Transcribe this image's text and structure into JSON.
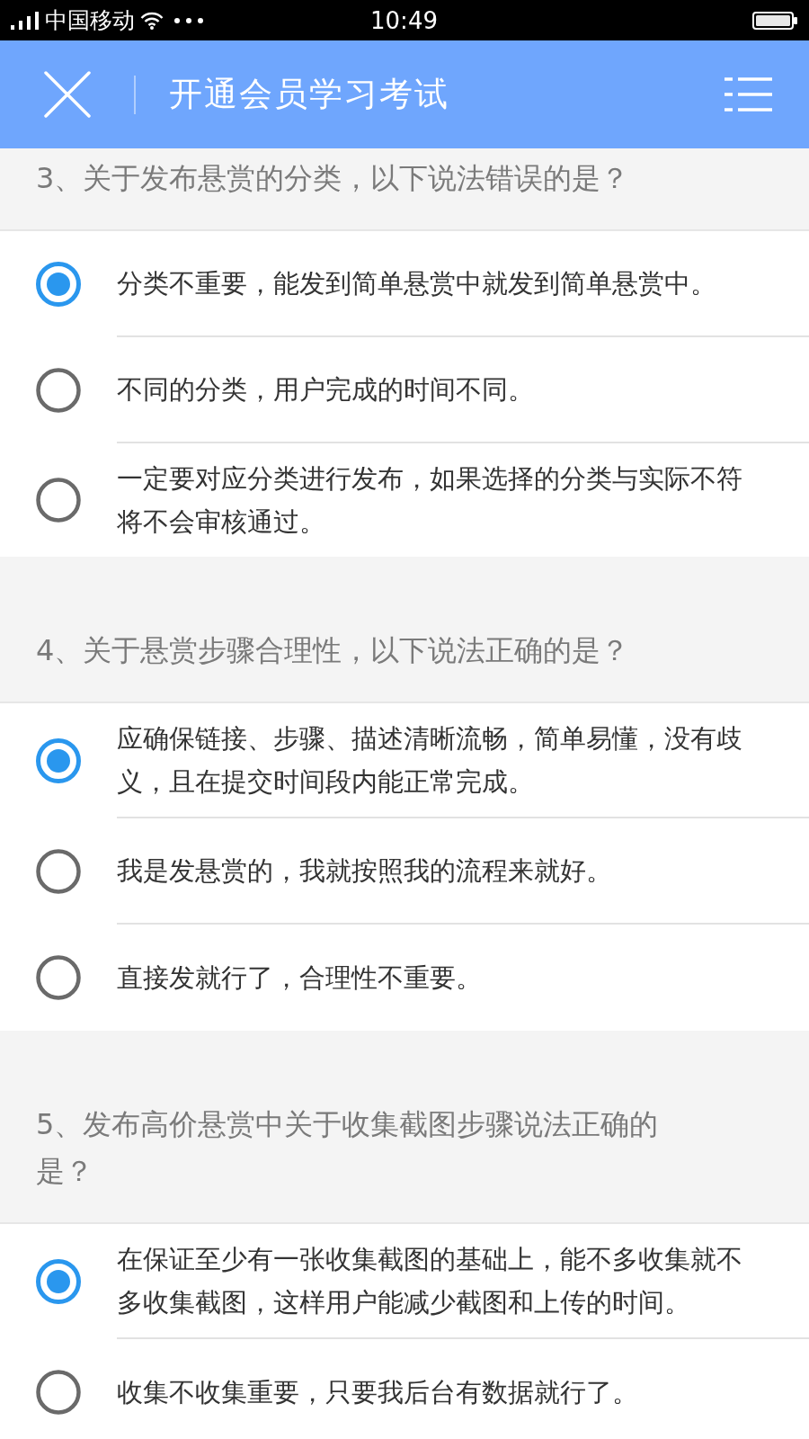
{
  "status_bar": {
    "carrier": "中国移动",
    "time": "10:49"
  },
  "header": {
    "title": "开通会员学习考试"
  },
  "questions": [
    {
      "text": "3、关于发布悬赏的分类，以下说法错误的是？",
      "options": [
        {
          "text": "分类不重要，能发到简单悬赏中就发到简单悬赏中。",
          "selected": true
        },
        {
          "text": "不同的分类，用户完成的时间不同。",
          "selected": false
        },
        {
          "text": "一定要对应分类进行发布，如果选择的分类与实际不符将不会审核通过。",
          "selected": false
        }
      ]
    },
    {
      "text": "4、关于悬赏步骤合理性，以下说法正确的是？",
      "options": [
        {
          "text": "应确保链接、步骤、描述清晰流畅，简单易懂，没有歧义，且在提交时间段内能正常完成。",
          "selected": true
        },
        {
          "text": "我是发悬赏的，我就按照我的流程来就好。",
          "selected": false
        },
        {
          "text": "直接发就行了，合理性不重要。",
          "selected": false
        }
      ]
    },
    {
      "text": "5、发布高价悬赏中关于收集截图步骤说法正确的是？",
      "options": [
        {
          "text": "在保证至少有一张收集截图的基础上，能不多收集就不多收集截图，这样用户能减少截图和上传的时间。",
          "selected": true
        },
        {
          "text": "收集不收集重要，只要我后台有数据就行了。",
          "selected": false
        }
      ]
    }
  ]
}
